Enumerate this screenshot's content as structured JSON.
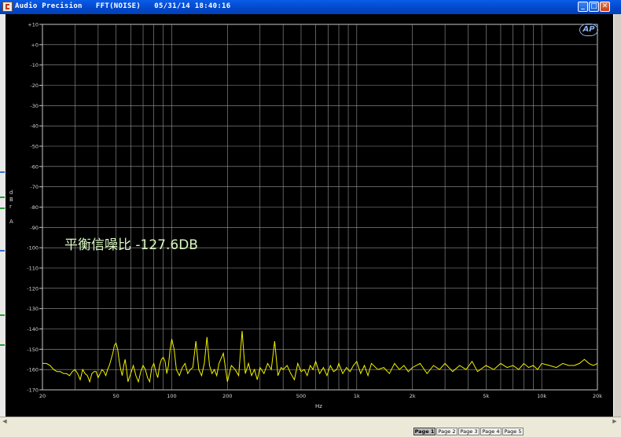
{
  "window": {
    "title": "Audio Precision   FFT(NOISE)   05/31/14 18:40:16",
    "buttons": {
      "minimize": "_",
      "maximize": "□",
      "close": "✕"
    }
  },
  "graph": {
    "annotation": "平衡信噪比 -127.6DB",
    "logo_text": "AP",
    "y_axis_letters": [
      "d",
      "B",
      "r",
      "A"
    ],
    "x_axis_title": "Hz",
    "trace_color": "#f2f200",
    "grid_color": "#9a9a9a"
  },
  "chart_data": {
    "type": "line",
    "xlabel": "Hz",
    "ylabel": "dBr A",
    "xscale": "log",
    "xlim": [
      20,
      20000
    ],
    "ylim": [
      -170,
      10
    ],
    "x_ticks": [
      {
        "value": 20,
        "label": "20"
      },
      {
        "value": 50,
        "label": "50"
      },
      {
        "value": 100,
        "label": "100"
      },
      {
        "value": 200,
        "label": "200"
      },
      {
        "value": 500,
        "label": "500"
      },
      {
        "value": 1000,
        "label": "1k"
      },
      {
        "value": 2000,
        "label": "2k"
      },
      {
        "value": 5000,
        "label": "5k"
      },
      {
        "value": 10000,
        "label": "10k"
      },
      {
        "value": 20000,
        "label": "20k"
      }
    ],
    "y_ticks": [
      "+10",
      "+0",
      "-10",
      "-20",
      "-30",
      "-40",
      "-50",
      "-60",
      "-70",
      "-80",
      "-90",
      "-100",
      "-110",
      "-120",
      "-130",
      "-140",
      "-150",
      "-160",
      "-170"
    ],
    "series": [
      {
        "x": [
          20,
          21,
          22,
          23,
          24,
          25,
          26,
          27,
          28,
          29,
          30,
          31,
          32,
          33,
          34,
          35,
          36,
          37,
          38,
          39,
          40,
          41,
          42,
          43,
          44,
          45,
          46,
          47,
          48,
          49,
          50,
          51,
          52,
          53,
          54,
          55,
          56,
          57,
          58,
          60,
          62,
          64,
          66,
          68,
          70,
          72,
          74,
          76,
          78,
          80,
          82,
          84,
          86,
          88,
          90,
          92,
          94,
          96,
          98,
          100,
          103,
          106,
          110,
          114,
          118,
          122,
          126,
          130,
          135,
          140,
          145,
          150,
          155,
          160,
          165,
          170,
          175,
          180,
          190,
          200,
          210,
          220,
          230,
          240,
          250,
          260,
          270,
          280,
          290,
          300,
          315,
          330,
          345,
          360,
          375,
          390,
          400,
          420,
          440,
          460,
          480,
          500,
          520,
          540,
          560,
          580,
          600,
          630,
          660,
          690,
          720,
          750,
          780,
          800,
          840,
          880,
          920,
          960,
          1000,
          1050,
          1100,
          1150,
          1200,
          1300,
          1400,
          1500,
          1600,
          1700,
          1800,
          1900,
          2000,
          2200,
          2400,
          2600,
          2800,
          3000,
          3300,
          3600,
          3900,
          4200,
          4500,
          5000,
          5500,
          6000,
          6500,
          7000,
          7500,
          8000,
          8500,
          9000,
          9500,
          10000,
          11000,
          12000,
          13000,
          14000,
          15000,
          16000,
          17000,
          18000,
          19000,
          20000
        ],
        "y": [
          -157,
          -157,
          -158,
          -160,
          -161,
          -161,
          -162,
          -162,
          -163,
          -161,
          -160,
          -162,
          -165,
          -160,
          -162,
          -163,
          -166,
          -162,
          -161,
          -161,
          -164,
          -162,
          -160,
          -161,
          -163,
          -160,
          -158,
          -155,
          -152,
          -148,
          -147,
          -150,
          -156,
          -160,
          -163,
          -158,
          -155,
          -160,
          -166,
          -162,
          -158,
          -163,
          -166,
          -161,
          -158,
          -160,
          -164,
          -166,
          -159,
          -157,
          -161,
          -164,
          -158,
          -155,
          -154,
          -156,
          -162,
          -158,
          -150,
          -145,
          -150,
          -160,
          -163,
          -159,
          -157,
          -162,
          -160,
          -159,
          -146,
          -160,
          -163,
          -157,
          -144,
          -158,
          -162,
          -160,
          -163,
          -157,
          -152,
          -166,
          -158,
          -160,
          -163,
          -141,
          -162,
          -157,
          -163,
          -160,
          -165,
          -159,
          -162,
          -157,
          -160,
          -146,
          -163,
          -159,
          -160,
          -158,
          -162,
          -165,
          -157,
          -161,
          -160,
          -163,
          -158,
          -160,
          -156,
          -162,
          -159,
          -163,
          -158,
          -161,
          -160,
          -157,
          -162,
          -159,
          -161,
          -158,
          -156,
          -162,
          -158,
          -163,
          -157,
          -160,
          -159,
          -162,
          -157,
          -160,
          -158,
          -161,
          -159,
          -157,
          -162,
          -158,
          -160,
          -157,
          -161,
          -158,
          -160,
          -156,
          -161,
          -158,
          -160,
          -157,
          -159,
          -158,
          -160,
          -157,
          -159,
          -158,
          -160,
          -157,
          -158,
          -159,
          -157,
          -158,
          -158,
          -157,
          -155,
          -157,
          -158,
          -157
        ]
      }
    ]
  },
  "pages": [
    "Page 1",
    "Page 2",
    "Page 3",
    "Page 4",
    "Page 5"
  ],
  "active_page": 0
}
